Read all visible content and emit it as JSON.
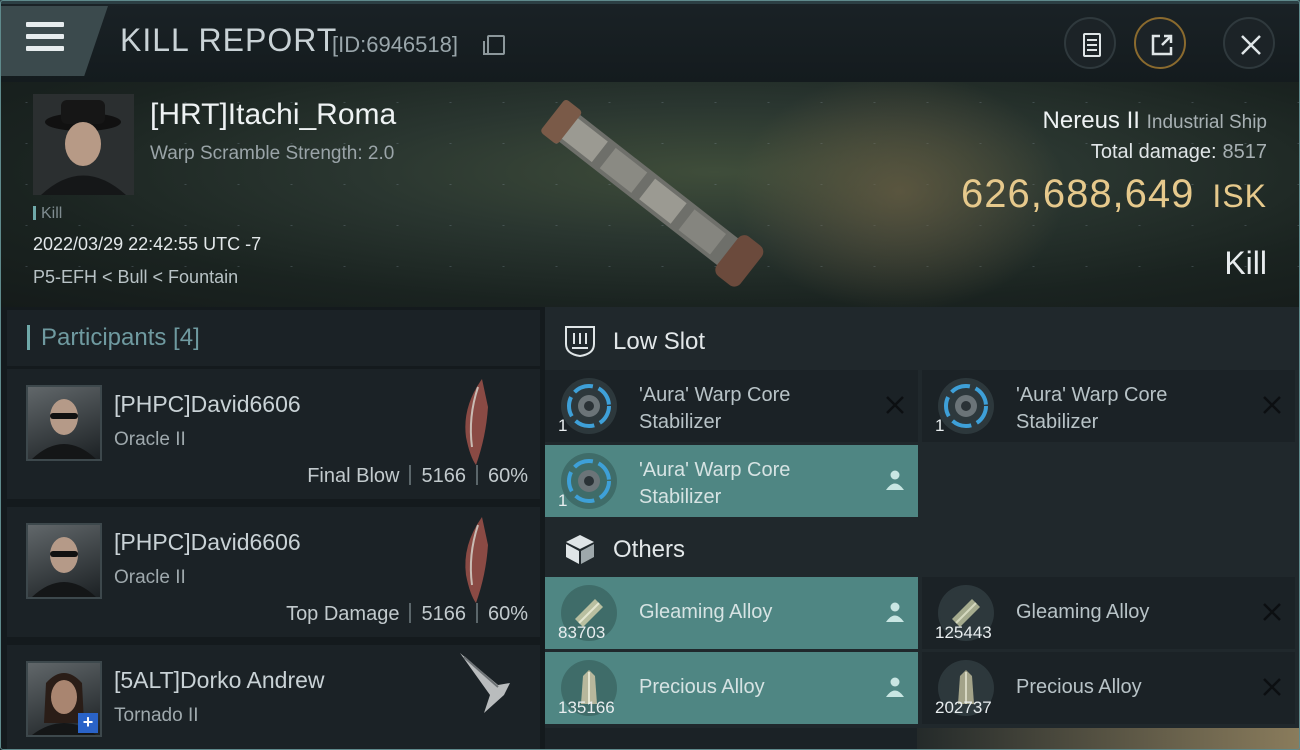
{
  "header": {
    "title": "KILL REPORT",
    "id_label": "[ID:6946518]"
  },
  "victim": {
    "name": "[HRT]Itachi_Roma",
    "warp_scramble": "Warp Scramble Strength: 2.0",
    "tag": "Kill",
    "datetime": "2022/03/29 22:42:55 UTC -7",
    "location": "P5-EFH < Bull < Fountain",
    "ship_name": "Nereus II",
    "ship_class": "Industrial Ship",
    "total_damage_label": "Total damage:",
    "total_damage": "8517",
    "isk_value": "626,688,649",
    "isk_unit": "ISK",
    "result": "Kill"
  },
  "participants": {
    "header": "Participants [4]",
    "items": [
      {
        "name": "[PHPC]David6606",
        "ship": "Oracle II",
        "role": "Final Blow",
        "damage": "5166",
        "percent": "60%"
      },
      {
        "name": "[PHPC]David6606",
        "ship": "Oracle II",
        "role": "Top Damage",
        "damage": "5166",
        "percent": "60%"
      },
      {
        "name": "[5ALT]Dorko Andrew",
        "ship": "Tornado II"
      }
    ]
  },
  "low_slot": {
    "label": "Low Slot",
    "items": [
      {
        "qty": "1",
        "name": "'Aura' Warp Core Stabilizer",
        "status": "destroyed"
      },
      {
        "qty": "1",
        "name": "'Aura' Warp Core Stabilizer",
        "status": "destroyed"
      },
      {
        "qty": "1",
        "name": "'Aura' Warp Core Stabilizer",
        "status": "dropped"
      }
    ]
  },
  "others": {
    "label": "Others",
    "items": [
      {
        "qty": "83703",
        "name": "Gleaming Alloy",
        "status": "dropped"
      },
      {
        "qty": "125443",
        "name": "Gleaming Alloy",
        "status": "destroyed"
      },
      {
        "qty": "135166",
        "name": "Precious Alloy",
        "status": "dropped"
      },
      {
        "qty": "202737",
        "name": "Precious Alloy",
        "status": "destroyed"
      }
    ]
  },
  "colors": {
    "accent_teal": "#4f8683",
    "isk_gold": "#e6c98c",
    "participants_accent": "#6fa9a9"
  },
  "icons": [
    "hamburger-menu-icon",
    "copy-icon",
    "clipboard-icon",
    "share-icon",
    "close-icon",
    "low-slot-icon",
    "box-icon",
    "person-icon",
    "x-mark-icon"
  ]
}
